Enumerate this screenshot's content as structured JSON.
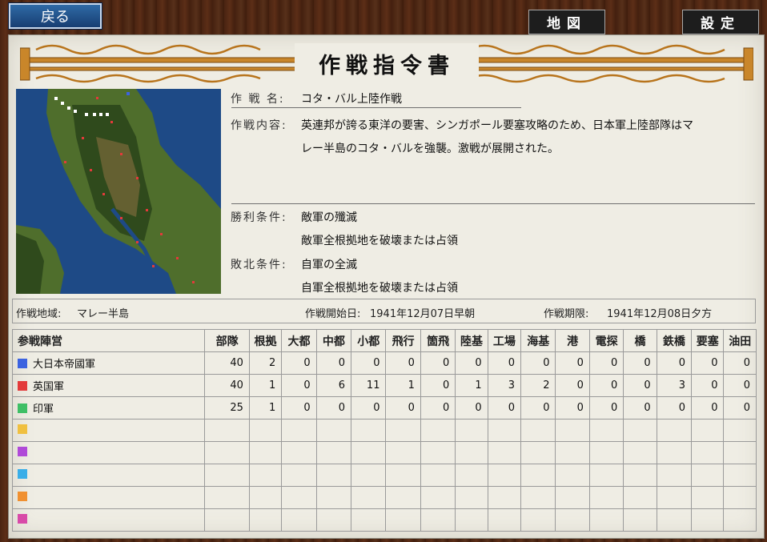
{
  "nav": {
    "back_label": "戻る",
    "map_label": "地図",
    "settings_label": "設定"
  },
  "title": "作戦指令書",
  "operation": {
    "name_label": "作 戦 名:",
    "name": "コタ・バル上陸作戦",
    "content_label": "作戦内容:",
    "content_line1": "英連邦が誇る東洋の要害、シンガポール要塞攻略のため、日本軍上陸部隊はマ",
    "content_line2": "レー半島のコタ・バルを強襲。激戦が展開された。",
    "victory_label": "勝利条件:",
    "victory_1": "敵軍の殲滅",
    "victory_2": "敵軍全根拠地を破壊または占領",
    "defeat_label": "敗北条件:",
    "defeat_1": "自軍の全滅",
    "defeat_2": "自軍全根拠地を破壊または占領"
  },
  "region": {
    "area_label": "作戦地域:",
    "area": "マレー半島",
    "start_label": "作戦開始日:",
    "start": "1941年12月07日早朝",
    "deadline_label": "作戦期限:",
    "deadline": "1941年12月08日夕方"
  },
  "table": {
    "headers": [
      "参戦陣営",
      "部隊",
      "根拠",
      "大都",
      "中都",
      "小都",
      "飛行",
      "箇飛",
      "陸基",
      "工場",
      "海基",
      "港",
      "電探",
      "橋",
      "鉄橋",
      "要塞",
      "油田"
    ],
    "rows": [
      {
        "faction": "大日本帝國軍",
        "color": "#3c63e0",
        "values": [
          "40",
          "2",
          "0",
          "0",
          "0",
          "0",
          "0",
          "0",
          "0",
          "0",
          "0",
          "0",
          "0",
          "0",
          "0",
          "0"
        ]
      },
      {
        "faction": "英国軍",
        "color": "#e33a3a",
        "values": [
          "40",
          "1",
          "0",
          "6",
          "11",
          "1",
          "0",
          "1",
          "3",
          "2",
          "0",
          "0",
          "0",
          "3",
          "0",
          "0"
        ]
      },
      {
        "faction": "印軍",
        "color": "#3fbf66",
        "values": [
          "25",
          "1",
          "0",
          "0",
          "0",
          "0",
          "0",
          "0",
          "0",
          "0",
          "0",
          "0",
          "0",
          "0",
          "0",
          "0"
        ]
      },
      {
        "faction": "",
        "color": "#f0c040",
        "values": [
          "",
          "",
          "",
          "",
          "",
          "",
          "",
          "",
          "",
          "",
          "",
          "",
          "",
          "",
          "",
          ""
        ]
      },
      {
        "faction": "",
        "color": "#b04ad8",
        "values": [
          "",
          "",
          "",
          "",
          "",
          "",
          "",
          "",
          "",
          "",
          "",
          "",
          "",
          "",
          "",
          ""
        ]
      },
      {
        "faction": "",
        "color": "#3aaee8",
        "values": [
          "",
          "",
          "",
          "",
          "",
          "",
          "",
          "",
          "",
          "",
          "",
          "",
          "",
          "",
          "",
          ""
        ]
      },
      {
        "faction": "",
        "color": "#f09030",
        "values": [
          "",
          "",
          "",
          "",
          "",
          "",
          "",
          "",
          "",
          "",
          "",
          "",
          "",
          "",
          "",
          ""
        ]
      },
      {
        "faction": "",
        "color": "#d84aa8",
        "values": [
          "",
          "",
          "",
          "",
          "",
          "",
          "",
          "",
          "",
          "",
          "",
          "",
          "",
          "",
          "",
          ""
        ]
      }
    ]
  },
  "minimap_colors": {
    "sea": "#1e4a86",
    "land": "#4f6e2c",
    "forest": "#2f4a1c",
    "mountain": "#7a6a3a",
    "enemy": "#e33a3a",
    "ally": "#ffffff"
  }
}
